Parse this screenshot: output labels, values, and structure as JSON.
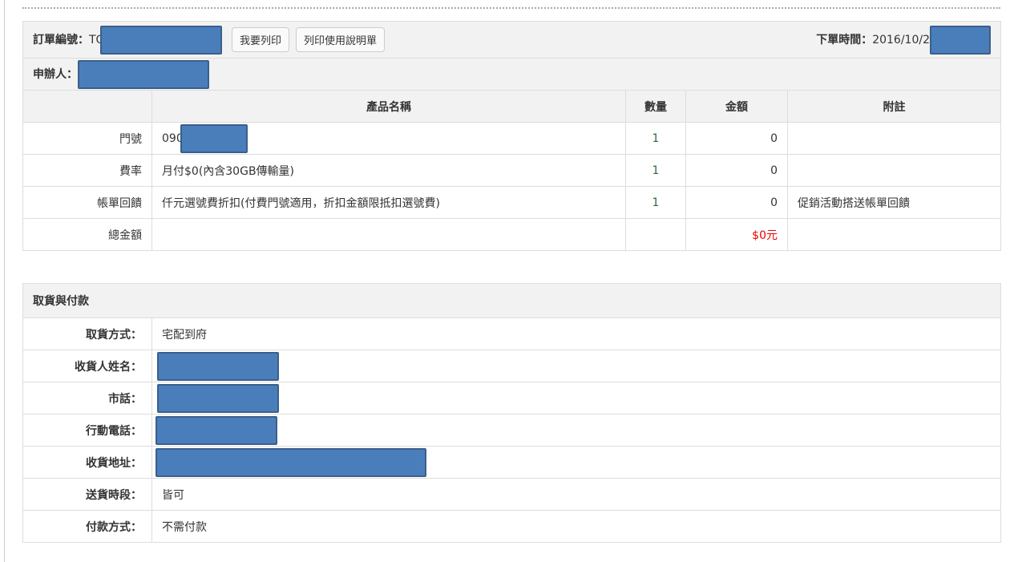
{
  "order": {
    "number_label": "訂單編號：",
    "number_prefix": "TO",
    "print_button": "我要列印",
    "print_guide_button": "列印使用說明單",
    "time_label": "下單時間：",
    "time_value": "2016/10/2",
    "applicant_label": "申辦人："
  },
  "items": {
    "headers": [
      "產品名稱",
      "數量",
      "金額",
      "附註"
    ],
    "rows": [
      {
        "label": "門號",
        "name": "090",
        "qty": "1",
        "amount": "0",
        "note": ""
      },
      {
        "label": "費率",
        "name": "月付$0(內含30GB傳輸量)",
        "qty": "1",
        "amount": "0",
        "note": ""
      },
      {
        "label": "帳單回饋",
        "name": "仟元選號費折扣(付費門號適用，折扣金額限抵扣選號費)",
        "qty": "1",
        "amount": "0",
        "note": "促銷活動搭送帳單回饋"
      }
    ],
    "total_label": "總金額",
    "total_value": "$0元"
  },
  "delivery": {
    "title": "取貨與付款",
    "rows": [
      {
        "label": "取貨方式：",
        "value": "宅配到府"
      },
      {
        "label": "收貨人姓名：",
        "value": ""
      },
      {
        "label": "市話：",
        "value": ""
      },
      {
        "label": "行動電話：",
        "value": ""
      },
      {
        "label": "收貨地址：",
        "value": ""
      },
      {
        "label": "送貨時段：",
        "value": "皆可"
      },
      {
        "label": "付款方式：",
        "value": "不需付款"
      }
    ]
  }
}
